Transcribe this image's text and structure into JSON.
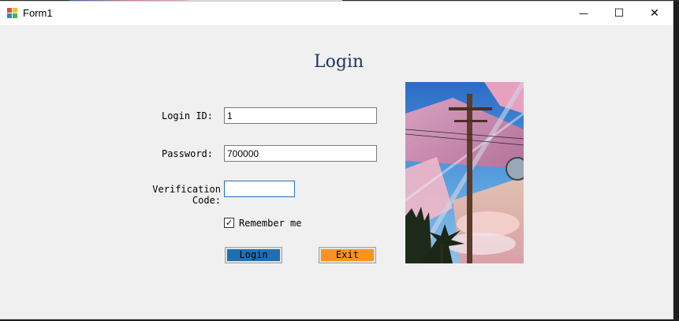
{
  "window": {
    "title": "Form1",
    "minimize_glyph": "—",
    "maximize_glyph": "☐",
    "close_glyph": "✕"
  },
  "form": {
    "heading": "Login",
    "login_id_label": "Login ID:",
    "login_id_value": "1",
    "password_label": "Password:",
    "password_value": "700000",
    "verification_label": "Verification Code:",
    "verification_value": "",
    "remember_label": "Remember me",
    "remember_checked": true,
    "login_button": "Login",
    "exit_button": "Exit"
  },
  "colors": {
    "login_button": "#1f6fb2",
    "exit_button": "#f7931e",
    "heading": "#1f3864"
  },
  "icons": {
    "app": "form-app-icon",
    "check": "✓"
  }
}
